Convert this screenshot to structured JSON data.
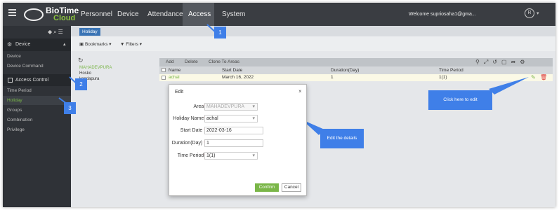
{
  "app": {
    "logo": "BioTime",
    "logo_sub": "Cloud"
  },
  "nav": [
    "Personnel",
    "Device",
    "Attendance",
    "Access",
    "System"
  ],
  "header": {
    "welcome": "Welcome supriosaha1@gma...",
    "user_icon": "R",
    "caret": "▾"
  },
  "sidebar": {
    "device_header": "Device",
    "device_items": [
      "Device",
      "Device Command"
    ],
    "access_header": "Access Control",
    "access_items": [
      "Time Period",
      "Holiday",
      "Groups",
      "Combination",
      "Privilege"
    ]
  },
  "tabs": {
    "active": "Holiday"
  },
  "toolbar": {
    "bookmarks": "Bookmarks",
    "filters": "Filters"
  },
  "areas": [
    "MAHADEVPURA",
    "Hosko",
    "kondapura"
  ],
  "grid": {
    "buttons": [
      "Add",
      "Delete",
      "Clone To Areas"
    ],
    "columns": [
      "Name",
      "Start Date",
      "Duration(Day)",
      "Time Period"
    ],
    "rows": [
      {
        "name": "achal",
        "start": "March 16, 2022",
        "duration": "1",
        "period": "1(1)"
      }
    ]
  },
  "dialog": {
    "title": "Edit",
    "close": "×",
    "fields": [
      {
        "label": "Area",
        "value": "MAHADEVPURA",
        "required": true,
        "select": true
      },
      {
        "label": "Holiday Name",
        "value": "achal",
        "required": true,
        "select": true
      },
      {
        "label": "Start Date",
        "value": "2022-03-16",
        "required": true,
        "select": false
      },
      {
        "label": "Duration(Day)",
        "value": "1",
        "required": true,
        "select": false
      },
      {
        "label": "Time Period",
        "value": "1(1)",
        "required": true,
        "select": true
      }
    ],
    "confirm": "Confirm",
    "cancel": "Cancel"
  },
  "callouts": {
    "edit_hint": "Click here to edit",
    "details_hint": "Edit the details",
    "steps": [
      "1",
      "2",
      "3"
    ]
  },
  "colors": {
    "topbar": "#3a3d42",
    "accent": "#3a74b5",
    "callout": "#3f7fe8",
    "confirm": "#7ab648"
  }
}
